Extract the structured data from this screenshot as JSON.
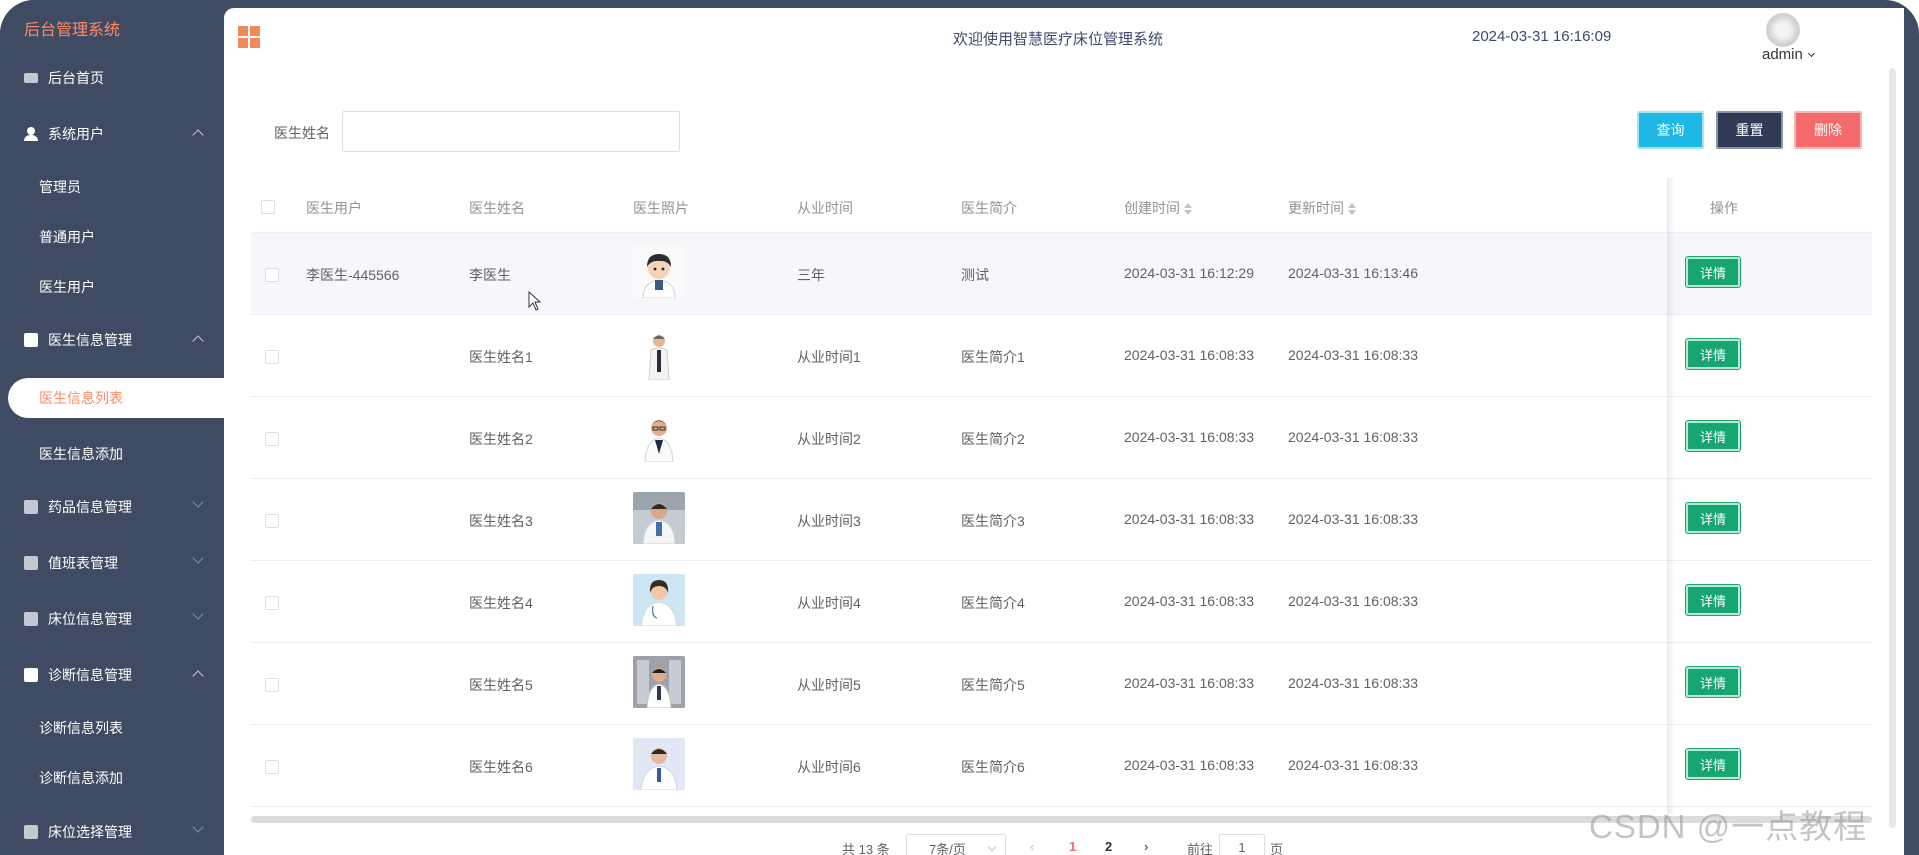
{
  "sidebar": {
    "brand": "后台管理系统",
    "items": [
      {
        "label": "后台首页",
        "icon": "monitor-icon"
      },
      {
        "label": "系统用户",
        "icon": "user-icon",
        "expanded": true
      },
      {
        "label": "管理员"
      },
      {
        "label": "普通用户"
      },
      {
        "label": "医生用户"
      },
      {
        "label": "医生信息管理",
        "icon": "chart-icon",
        "expanded": true
      },
      {
        "label": "医生信息列表",
        "active": true
      },
      {
        "label": "医生信息添加"
      },
      {
        "label": "药品信息管理",
        "icon": "chart-icon"
      },
      {
        "label": "值班表管理",
        "icon": "chart-icon"
      },
      {
        "label": "床位信息管理",
        "icon": "chart-icon"
      },
      {
        "label": "诊断信息管理",
        "icon": "chart-icon",
        "expanded": true
      },
      {
        "label": "诊断信息列表"
      },
      {
        "label": "诊断信息添加"
      },
      {
        "label": "床位选择管理",
        "icon": "chart-icon"
      }
    ]
  },
  "header": {
    "title": "欢迎使用智慧医疗床位管理系统",
    "datetime": "2024-03-31 16:16:09",
    "username": "admin"
  },
  "search": {
    "label": "医生姓名",
    "value": "",
    "placeholder": ""
  },
  "buttons": {
    "query": "查询",
    "reset": "重置",
    "delete": "删除"
  },
  "table": {
    "columns": [
      "医生用户",
      "医生姓名",
      "医生照片",
      "从业时间",
      "医生简介",
      "创建时间",
      "更新时间",
      "操作"
    ],
    "detail_label": "详情",
    "rows": [
      {
        "user": "李医生-445566",
        "name": "李医生",
        "years": "三年",
        "intro": "测试",
        "created": "2024-03-31 16:12:29",
        "updated": "2024-03-31 16:13:46"
      },
      {
        "user": "",
        "name": "医生姓名1",
        "years": "从业时间1",
        "intro": "医生简介1",
        "created": "2024-03-31 16:08:33",
        "updated": "2024-03-31 16:08:33"
      },
      {
        "user": "",
        "name": "医生姓名2",
        "years": "从业时间2",
        "intro": "医生简介2",
        "created": "2024-03-31 16:08:33",
        "updated": "2024-03-31 16:08:33"
      },
      {
        "user": "",
        "name": "医生姓名3",
        "years": "从业时间3",
        "intro": "医生简介3",
        "created": "2024-03-31 16:08:33",
        "updated": "2024-03-31 16:08:33"
      },
      {
        "user": "",
        "name": "医生姓名4",
        "years": "从业时间4",
        "intro": "医生简介4",
        "created": "2024-03-31 16:08:33",
        "updated": "2024-03-31 16:08:33"
      },
      {
        "user": "",
        "name": "医生姓名5",
        "years": "从业时间5",
        "intro": "医生简介5",
        "created": "2024-03-31 16:08:33",
        "updated": "2024-03-31 16:08:33"
      },
      {
        "user": "",
        "name": "医生姓名6",
        "years": "从业时间6",
        "intro": "医生简介6",
        "created": "2024-03-31 16:08:33",
        "updated": "2024-03-31 16:08:33"
      }
    ]
  },
  "pagination": {
    "total": "共 13 条",
    "page_size": "7条/页",
    "prev": "‹",
    "pages": [
      "1",
      "2"
    ],
    "current": "1",
    "next": "›",
    "goto": "前往",
    "goto_value": "1",
    "page_suffix": "页"
  },
  "watermark": "CSDN @一点教程",
  "colors": {
    "sidebar_bg": "#3f4a63",
    "brand": "#ff8b6a",
    "query": "#1fb8e6",
    "reset": "#2f3a55",
    "delete": "#f56a6a",
    "detail": "#17a673"
  }
}
